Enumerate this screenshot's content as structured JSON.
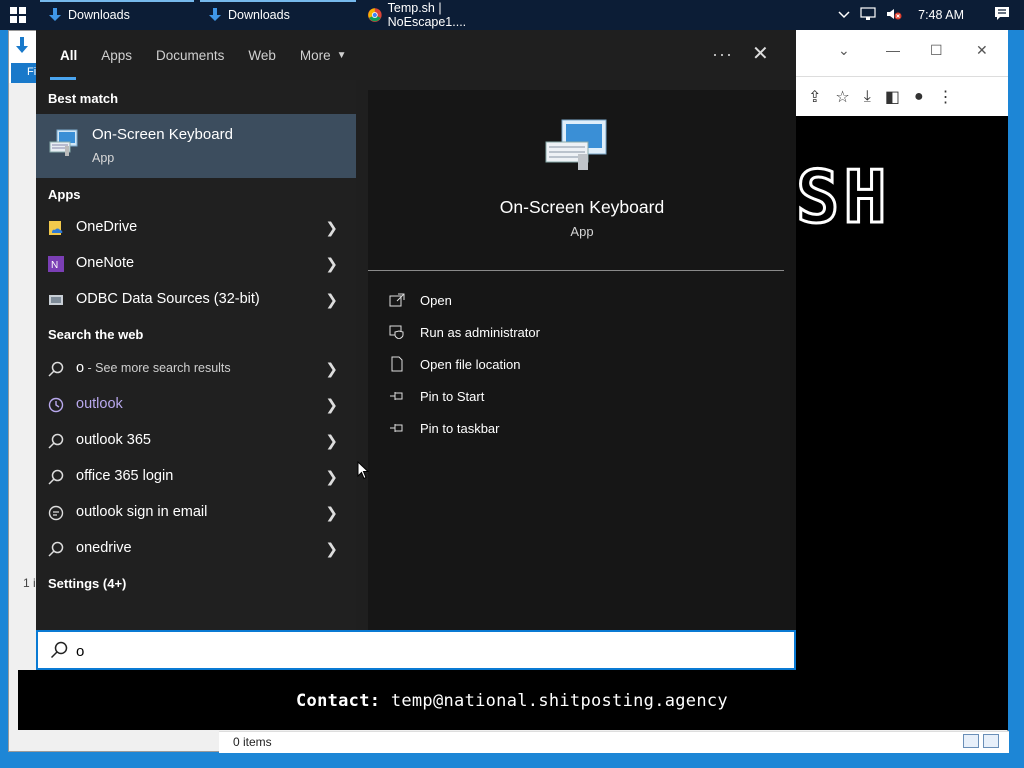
{
  "taskbar": {
    "apps": [
      {
        "label": "Downloads",
        "icon": "download-arrow-icon"
      },
      {
        "label": "Downloads",
        "icon": "download-arrow-icon"
      },
      {
        "label": "Temp.sh | NoEscape1....",
        "icon": "chrome-icon"
      }
    ],
    "clock": "7:48 AM"
  },
  "explorer": {
    "ribbon_tab": "Fi",
    "status_items": "0 items",
    "left_count": "1 i"
  },
  "chrome": {
    "logo_text": "SH"
  },
  "banner": {
    "contact_label": "Contact:",
    "contact_value": "temp@national.shitposting.agency"
  },
  "search": {
    "tabs": [
      "All",
      "Apps",
      "Documents",
      "Web",
      "More"
    ],
    "query": "o",
    "sections": {
      "best_match": "Best match",
      "apps": "Apps",
      "web": "Search the web",
      "settings": "Settings (4+)"
    },
    "best_match": {
      "title": "On-Screen Keyboard",
      "subtitle": "App"
    },
    "apps": [
      {
        "label": "OneDrive",
        "icon": "onedrive-icon"
      },
      {
        "label": "OneNote",
        "icon": "onenote-icon"
      },
      {
        "label": "ODBC Data Sources (32-bit)",
        "icon": "odbc-icon"
      }
    ],
    "web": [
      {
        "label": "o",
        "sub": " - See more search results",
        "icon": "search-icon"
      },
      {
        "label": "outlook",
        "icon": "history-icon"
      },
      {
        "label": "outlook 365",
        "icon": "search-icon"
      },
      {
        "label": "office 365 login",
        "icon": "search-icon"
      },
      {
        "label": "outlook sign in email",
        "icon": "chat-icon"
      },
      {
        "label": "onedrive",
        "icon": "search-icon"
      }
    ],
    "detail": {
      "title": "On-Screen Keyboard",
      "type": "App",
      "actions": [
        {
          "label": "Open",
          "icon": "open-icon"
        },
        {
          "label": "Run as administrator",
          "icon": "shield-icon"
        },
        {
          "label": "Open file location",
          "icon": "file-icon"
        },
        {
          "label": "Pin to Start",
          "icon": "pin-icon"
        },
        {
          "label": "Pin to taskbar",
          "icon": "pin-icon"
        }
      ]
    }
  },
  "colors": {
    "accent": "#0a7ad3",
    "selected": "#3c4d5e",
    "link": "#b9a9ee",
    "panel": "#202020"
  }
}
